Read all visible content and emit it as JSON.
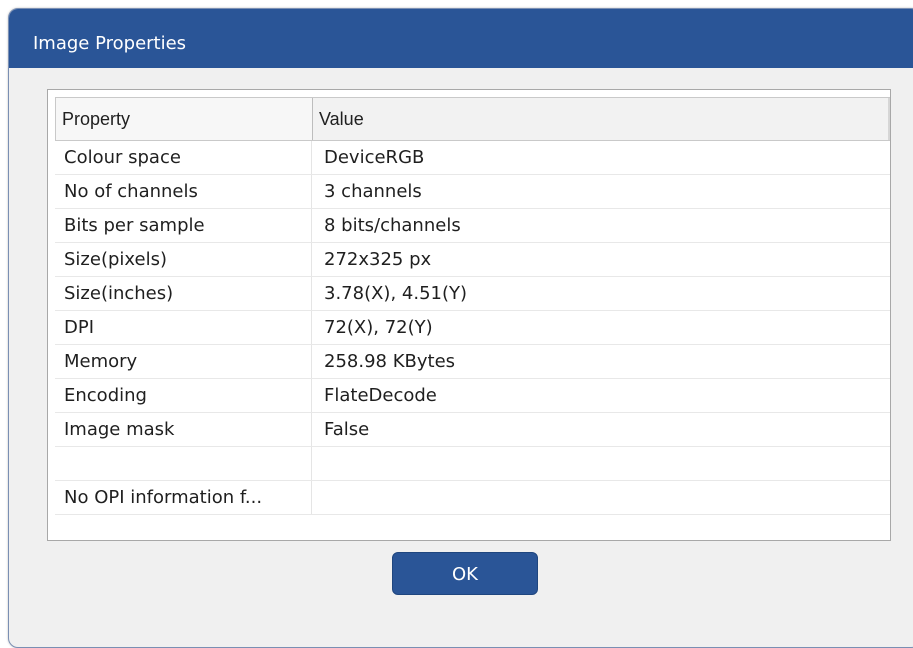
{
  "window": {
    "title": "Image Properties"
  },
  "table": {
    "headers": {
      "property": "Property",
      "value": "Value"
    },
    "rows": [
      {
        "property": "Colour space",
        "value": "DeviceRGB"
      },
      {
        "property": "No of channels",
        "value": "3 channels"
      },
      {
        "property": "Bits per sample",
        "value": "8 bits/channels"
      },
      {
        "property": "Size(pixels)",
        "value": "272x325 px"
      },
      {
        "property": "Size(inches)",
        "value": "3.78(X), 4.51(Y)"
      },
      {
        "property": "DPI",
        "value": "72(X), 72(Y)"
      },
      {
        "property": "Memory",
        "value": "258.98 KBytes"
      },
      {
        "property": "Encoding",
        "value": "FlateDecode"
      },
      {
        "property": "Image mask",
        "value": "False"
      },
      {
        "property": "",
        "value": ""
      },
      {
        "property": "No OPI information f...",
        "value": ""
      }
    ]
  },
  "buttons": {
    "ok": "OK"
  },
  "colors": {
    "titlebar": "#2a5597",
    "button": "#2a5597",
    "dialog_background": "#f0f0f0"
  }
}
